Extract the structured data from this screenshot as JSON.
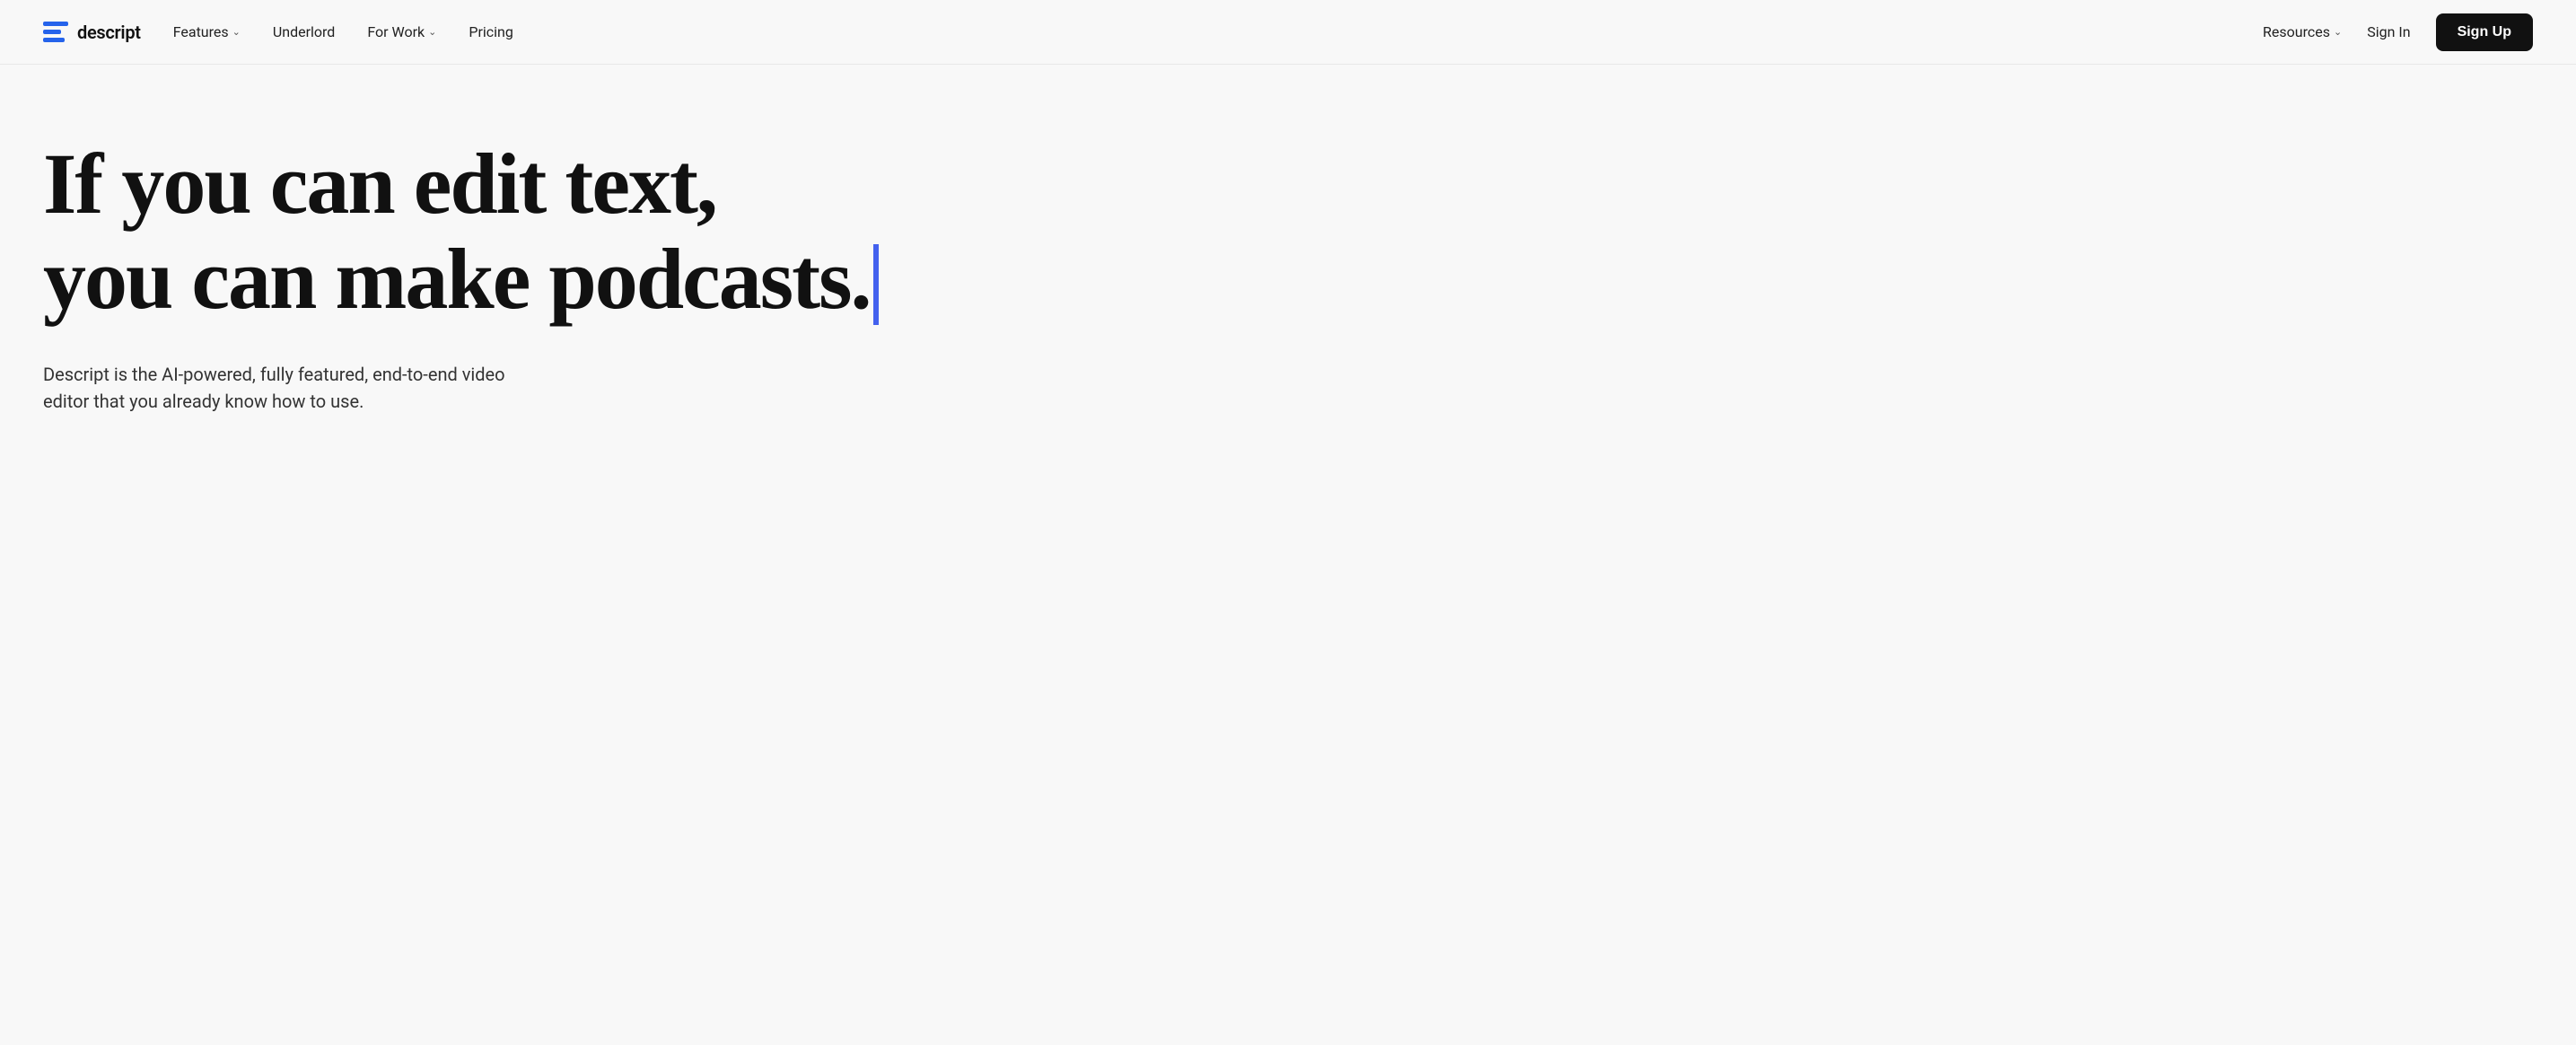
{
  "nav": {
    "logo": {
      "text": "descript"
    },
    "items": [
      {
        "label": "Features",
        "has_dropdown": true
      },
      {
        "label": "Underlord",
        "has_dropdown": false
      },
      {
        "label": "For Work",
        "has_dropdown": true
      },
      {
        "label": "Pricing",
        "has_dropdown": false
      }
    ],
    "right_items": [
      {
        "label": "Resources",
        "has_dropdown": true
      },
      {
        "label": "Sign In",
        "has_dropdown": false
      }
    ],
    "signup_label": "Sign Up"
  },
  "hero": {
    "headline_line1": "If you can edit text,",
    "headline_line2": "you can make podcasts.",
    "subtext": "Descript is the AI-powered, fully featured, end-to-end video editor that you already know how to use."
  },
  "colors": {
    "accent_blue": "#4361ee",
    "logo_blue": "#2563eb"
  }
}
